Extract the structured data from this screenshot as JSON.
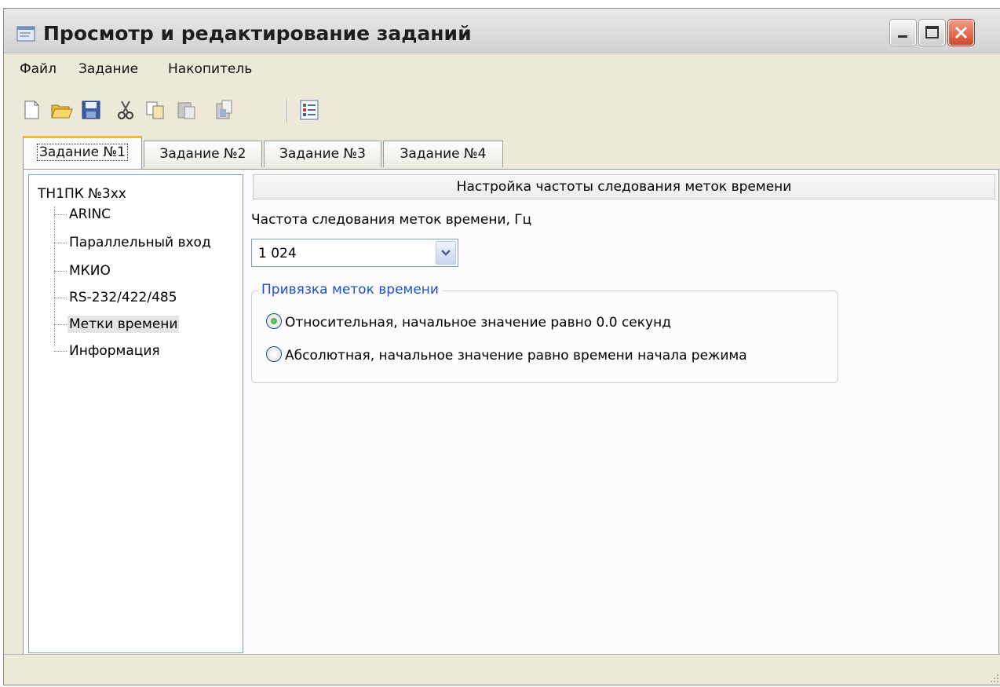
{
  "window": {
    "title": "Просмотр и редактирование заданий",
    "buttons": {
      "minimize": "_",
      "maximize": "□",
      "close": "X"
    }
  },
  "menu": {
    "items": [
      "Файл",
      "Задание",
      "Накопитель"
    ]
  },
  "toolbar": {
    "icons": [
      "new-icon",
      "open-icon",
      "save-icon",
      "cut-icon",
      "copy-icon",
      "paste-icon",
      "paste-special-icon",
      "properties-icon"
    ]
  },
  "tabs": [
    {
      "label": "Задание №1",
      "active": true
    },
    {
      "label": "Задание №2",
      "active": false
    },
    {
      "label": "Задание №3",
      "active": false
    },
    {
      "label": "Задание №4",
      "active": false
    }
  ],
  "tree": {
    "root": "ТН1ПК №3xx",
    "items": [
      {
        "label": "ARINC",
        "selected": false
      },
      {
        "label": "Параллельный вход",
        "selected": false
      },
      {
        "label": "МКИО",
        "selected": false
      },
      {
        "label": "RS-232/422/485",
        "selected": false
      },
      {
        "label": "Метки времени",
        "selected": true
      },
      {
        "label": "Информация",
        "selected": false
      }
    ]
  },
  "settings": {
    "header": "Настройка частоты следования меток времени",
    "frequency_label": "Частота следования меток времени, Гц",
    "frequency_value": "1 024",
    "binding_group_title": "Привязка меток времени",
    "options": [
      {
        "label": "Относительная, начальное значение равно 0.0 секунд",
        "checked": true
      },
      {
        "label": "Абсолютная, начальное значение равно времени начала режима",
        "checked": false
      }
    ]
  },
  "colors": {
    "window_bg": "#ece9d8",
    "tab_active_accent": "#f4b73a",
    "group_title": "#1f4fc6",
    "close_button": "#d2482b"
  }
}
